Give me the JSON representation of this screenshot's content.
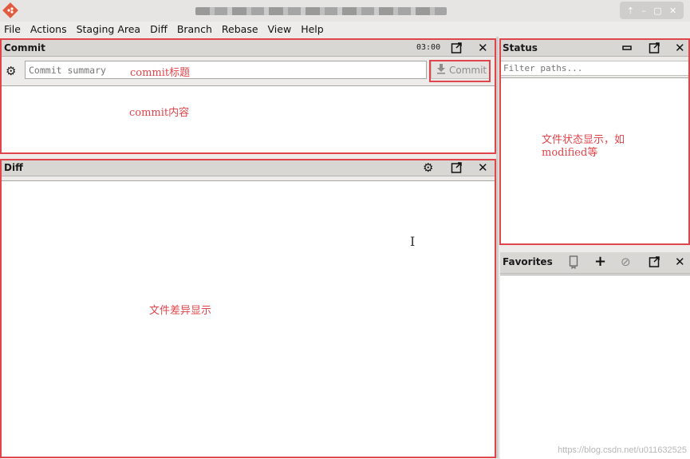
{
  "menu": [
    "File",
    "Actions",
    "Staging Area",
    "Diff",
    "Branch",
    "Rebase",
    "View",
    "Help"
  ],
  "commit_pane": {
    "title": "Commit",
    "timer": "03:00",
    "summary_placeholder": "Commit summary",
    "commit_button": "Commit"
  },
  "diff_pane": {
    "title": "Diff"
  },
  "status_pane": {
    "title": "Status",
    "filter_placeholder": "Filter paths..."
  },
  "favorites_pane": {
    "title": "Favorites"
  },
  "annotations": {
    "commit_title": "commit标题",
    "commit_content": "commit内容",
    "status_desc_line1": "文件状态显示，如",
    "status_desc_line2": "modified等",
    "diff_desc": "文件差异显示"
  },
  "watermark": "https://blog.csdn.net/u011632525",
  "colors": {
    "annotation_red": "#e0454b",
    "header_bg": "#d9d7d4",
    "logo": "#e05a3d"
  }
}
